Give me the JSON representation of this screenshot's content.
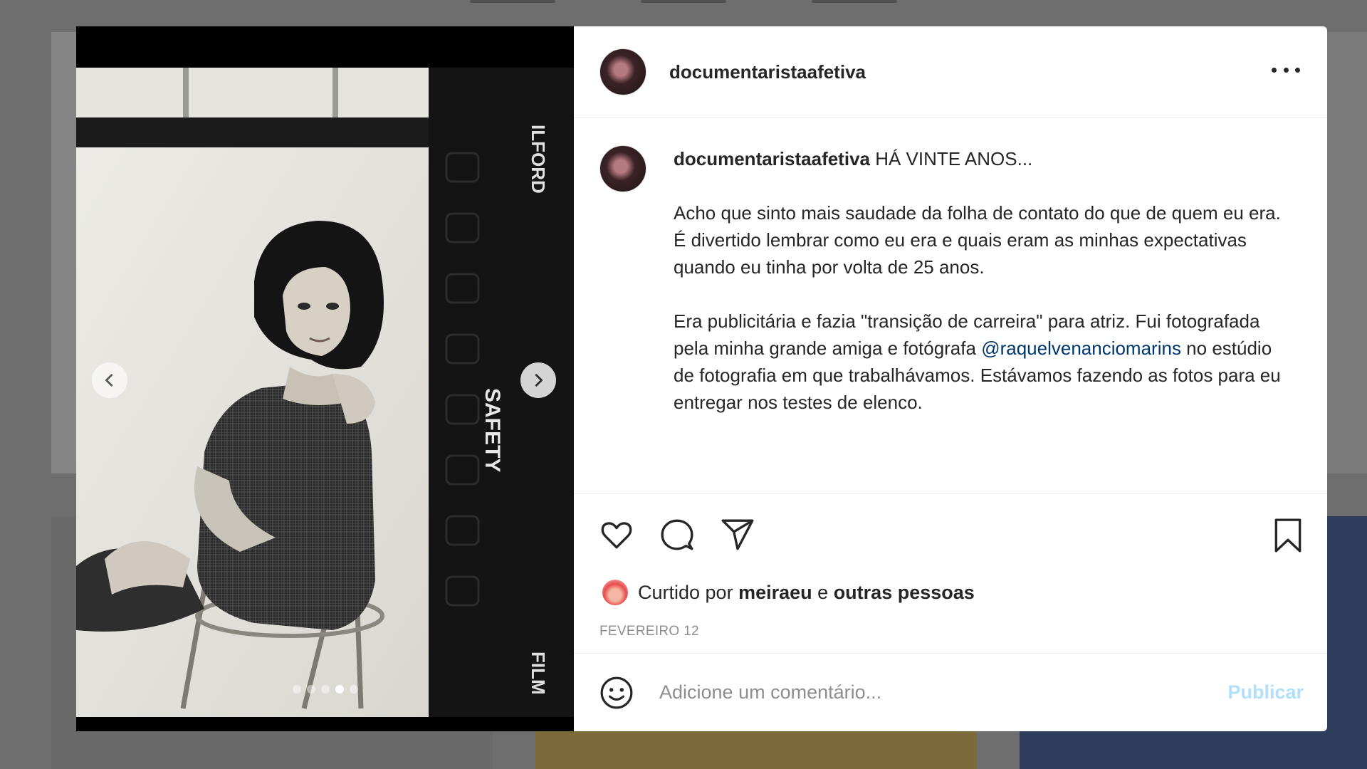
{
  "post": {
    "username": "documentarista",
    "header_username": "documentaristaafetiva",
    "caption_username": "documentaristaafetiva",
    "caption_title": "HÁ VINTE ANOS...",
    "caption_para1": "Acho que sinto mais saudade da folha de contato do que de quem eu era. É divertido lembrar como eu era e quais eram as minhas expectativas quando eu tinha por volta de 25 anos.",
    "caption_para2_before": "Era publicitária e fazia \"transição de carreira\" para atriz. Fui fotografada pela minha grande amiga e fotógrafa ",
    "mention": "@raquelvenanciomarins",
    "caption_para2_after": " no estúdio de fotografia em que trabalhávamos. Estávamos fazendo as fotos para eu entregar nos testes de elenco.",
    "likes_prefix": "Curtido por ",
    "likes_user": "meiraeu",
    "likes_middle": " e ",
    "likes_others": "outras pessoas",
    "date": "FEVEREIRO 12",
    "carousel_count": 5,
    "carousel_active": 4
  },
  "film": {
    "edge_text_top": "ILFORD",
    "edge_text_mid": "SAFETY",
    "edge_text_bottom": "FILM"
  },
  "comment": {
    "placeholder": "Adicione um comentário...",
    "publish_label": "Publicar"
  },
  "icons": {
    "like": "heart-icon",
    "comment": "comment-icon",
    "share": "send-icon",
    "save": "bookmark-icon",
    "emoji": "emoji-icon",
    "more": "more-options-icon",
    "prev": "chevron-left-icon",
    "next": "chevron-right-icon"
  },
  "colors": {
    "mention": "#00376b",
    "publish_disabled": "#b2dffc",
    "muted": "#8e8e8e"
  }
}
